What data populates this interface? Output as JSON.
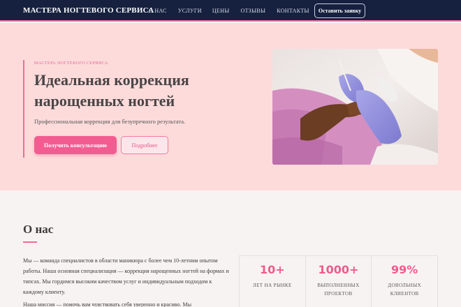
{
  "nav": {
    "logo": "МАСТЕРА НОГТЕВОГО СЕРВИСА",
    "items": [
      "О НАС",
      "УСЛУГИ",
      "ЦЕНЫ",
      "ОТЗЫВЫ",
      "КОНТАКТЫ"
    ],
    "cta": "Оставить заявку"
  },
  "hero": {
    "eyebrow": "МАСТЕРА НОГТЕВОГО СЕРВИСА",
    "title": "Идеальная коррекция нарощенных ногтей",
    "subtitle": "Профессиональная коррекция для безупречного результата.",
    "primary_button": "Получить консультацию",
    "secondary_button": "Подробнее"
  },
  "about": {
    "title": "О нас",
    "paragraph1": "Мы — команда специалистов в области маникюра с более чем 10-летним опытом работы. Наша основная специализация — коррекция нарощенных ногтей на формах и типсах. Мы гордимся высоким качеством услуг и индивидуальным подходом к каждому клиенту.",
    "paragraph2": "Наша миссия — помочь вам чувствовать себя уверенно и красиво. Мы",
    "stats": [
      {
        "value": "10+",
        "label": "ЛЕТ НА РЫНКЕ"
      },
      {
        "value": "1000+",
        "label": "ВЫПОЛНЕННЫХ ПРОЕКТОВ"
      },
      {
        "value": "99%",
        "label": "ДОВОЛЬНЫХ КЛИЕНТОВ"
      }
    ]
  },
  "colors": {
    "nav_bg": "#16213f",
    "accent": "#f25c90",
    "hero_bg": "#fddbdb"
  }
}
